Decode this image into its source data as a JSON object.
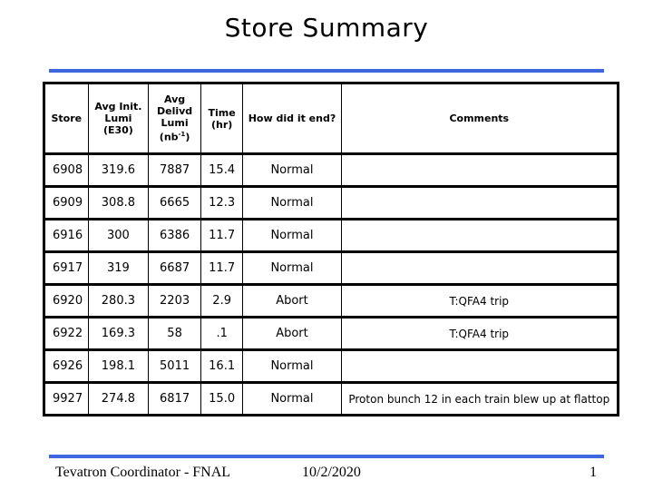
{
  "title": "Store Summary",
  "table": {
    "headers": [
      {
        "lines": [
          "Store"
        ]
      },
      {
        "lines": [
          "Avg Init.",
          "Lumi",
          "(E30)"
        ]
      },
      {
        "lines": [
          "Avg",
          "Delivd",
          "Lumi",
          "(nb-1)"
        ]
      },
      {
        "lines": [
          "Time",
          "(hr)"
        ]
      },
      {
        "lines": [
          "How did it end?"
        ]
      },
      {
        "lines": [
          "Comments"
        ]
      }
    ],
    "header_text": {
      "store": "Store",
      "init_l1": "Avg Init.",
      "init_l2": "Lumi",
      "init_l3": "(E30)",
      "deliv_l1": "Avg",
      "deliv_l2": "Delivd",
      "deliv_l3": "Lumi",
      "deliv_l4_pre": "(nb",
      "deliv_l4_sup": "-1",
      "deliv_l4_post": ")",
      "time_l1": "Time",
      "time_l2": "(hr)",
      "end": "How did it end?",
      "comments": "Comments"
    },
    "rows": [
      {
        "store": "6908",
        "init_lumi": "319.6",
        "delivered_lumi": "7887",
        "time": "15.4",
        "end": "Normal",
        "comment": ""
      },
      {
        "store": "6909",
        "init_lumi": "308.8",
        "delivered_lumi": "6665",
        "time": "12.3",
        "end": "Normal",
        "comment": ""
      },
      {
        "store": "6916",
        "init_lumi": "300",
        "delivered_lumi": "6386",
        "time": "11.7",
        "end": "Normal",
        "comment": ""
      },
      {
        "store": "6917",
        "init_lumi": "319",
        "delivered_lumi": "6687",
        "time": "11.7",
        "end": "Normal",
        "comment": ""
      },
      {
        "store": "6920",
        "init_lumi": "280.3",
        "delivered_lumi": "2203",
        "time": "2.9",
        "end": "Abort",
        "comment": "T:QFA4 trip"
      },
      {
        "store": "6922",
        "init_lumi": "169.3",
        "delivered_lumi": "58",
        "time": ".1",
        "end": "Abort",
        "comment": "T:QFA4 trip"
      },
      {
        "store": "6926",
        "init_lumi": "198.1",
        "delivered_lumi": "5011",
        "time": "16.1",
        "end": "Normal",
        "comment": ""
      },
      {
        "store": "9927",
        "init_lumi": "274.8",
        "delivered_lumi": "6817",
        "time": "15.0",
        "end": "Normal",
        "comment": "Proton bunch 12 in each train blew up at flattop"
      }
    ]
  },
  "footer": {
    "left": "Tevatron Coordinator - FNAL",
    "center": "10/2/2020",
    "right": "1"
  },
  "colors": {
    "accent_rule": "#3f67dd",
    "table_border": "#000000"
  }
}
